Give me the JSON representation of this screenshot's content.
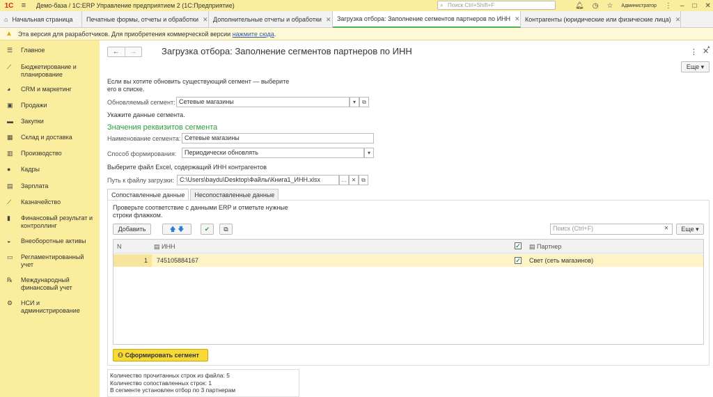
{
  "titlebar": {
    "logo": "1С",
    "app_title": "Демо-база / 1С:ERP Управление предприятием 2  (1С:Предприятие)",
    "search_placeholder": "Поиск Ctrl+Shift+F",
    "user": "Администратор"
  },
  "tabs": [
    {
      "label": "Начальная страница"
    },
    {
      "label": "Печатные формы, отчеты и обработки"
    },
    {
      "label": "Дополнительные отчеты и обработки"
    },
    {
      "label": "Загрузка отбора: Заполнение сегментов партнеров по ИНН"
    },
    {
      "label": "Контрагенты (юридические или физические лица)"
    }
  ],
  "devbar": {
    "text": "Эта версия для разработчиков. Для приобретения коммерческой версии",
    "link": "нажмите сюда",
    "suffix": "."
  },
  "sidebar": {
    "items": [
      {
        "label": "Главное"
      },
      {
        "label": "Бюджетирование и планирование"
      },
      {
        "label": "CRM и маркетинг"
      },
      {
        "label": "Продажи"
      },
      {
        "label": "Закупки"
      },
      {
        "label": "Склад и доставка"
      },
      {
        "label": "Производство"
      },
      {
        "label": "Кадры"
      },
      {
        "label": "Зарплата"
      },
      {
        "label": "Казначейство"
      },
      {
        "label": "Финансовый результат и контроллинг"
      },
      {
        "label": "Внеоборотные активы"
      },
      {
        "label": "Регламентированный учет"
      },
      {
        "label": "Международный финансовый учет"
      },
      {
        "label": "НСИ и администрирование"
      }
    ]
  },
  "form": {
    "title": "Загрузка отбора: Заполнение сегментов партнеров по ИНН",
    "more_label": "Еще",
    "hint1": "Если вы хотите обновить существующий сегмент — выберите его в списке.",
    "segment_label": "Обновляемый сегмент:",
    "segment_value": "Сетевые магазины",
    "hint2": "Укажите данные сегмента.",
    "group_title": "Значения реквизитов сегмента",
    "name_label": "Наименование сегмента:",
    "name_value": "Сетевые магазины",
    "method_label": "Способ формирования:",
    "method_value": "Периодически обновлять",
    "hint3": "Выберите файл Excel, содержащий ИНН контрагентов",
    "path_label": "Путь к файлу загрузки:",
    "path_value": "C:\\Users\\baydu\\Desktop\\Файлы\\Книга1_ИНН.xlsx"
  },
  "subtabs": [
    {
      "label": "Сопоставленные данные"
    },
    {
      "label": "Несопоставленные данные"
    }
  ],
  "panel": {
    "hint": "Проверьте соответствие с данными ERP и отметьте нужные строки флажком.",
    "add_label": "Добавить",
    "search_placeholder": "Поиск (Ctrl+F)",
    "more_label": "Еще",
    "columns": {
      "n": "N",
      "inn": "ИНН",
      "partner": "Партнер"
    },
    "rows": [
      {
        "n": "1",
        "inn": "745105884167",
        "checked": true,
        "partner": "Свет (сеть магазинов)"
      }
    ],
    "form_button": "Сформировать сегмент"
  },
  "info": {
    "lines": [
      "Количество прочитанных строк из файла: 5",
      "Количество сопоставленных строк: 1",
      "В сегменте установлен отбор по 3 партнерам"
    ]
  },
  "colors": {
    "accent_yellow": "#fbed9e",
    "button_yellow": "#f7d938",
    "group_green": "#2e9b3c",
    "row_highlight": "#fdf3c4"
  }
}
